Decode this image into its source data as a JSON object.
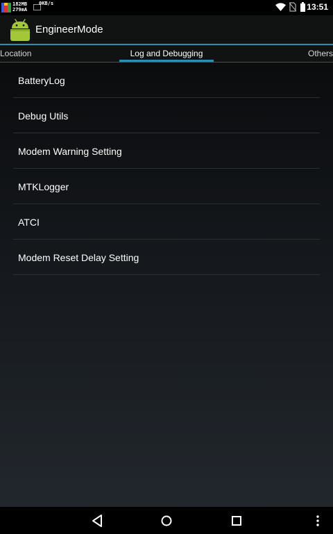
{
  "status_bar": {
    "mem_line1": "182MB",
    "mem_line2": "279mA",
    "net_speed": "0KB/s",
    "time": "13:51"
  },
  "action_bar": {
    "title": "EngineerMode",
    "icon": "android-robot-icon"
  },
  "tabs": [
    {
      "label": "Location",
      "selected": false
    },
    {
      "label": "Log and Debugging",
      "selected": true
    },
    {
      "label": "Others",
      "selected": false
    }
  ],
  "menu": {
    "items": [
      {
        "label": "BatteryLog"
      },
      {
        "label": "Debug Utils"
      },
      {
        "label": "Modem Warning Setting"
      },
      {
        "label": "MTKLogger"
      },
      {
        "label": "ATCI"
      },
      {
        "label": "Modem Reset Delay Setting"
      }
    ]
  },
  "nav_bar": {
    "icons": [
      "back-icon",
      "home-icon",
      "recents-icon",
      "overflow-menu-icon"
    ]
  },
  "colors": {
    "accent": "#2b8fb3",
    "android_green": "#a4c639"
  }
}
